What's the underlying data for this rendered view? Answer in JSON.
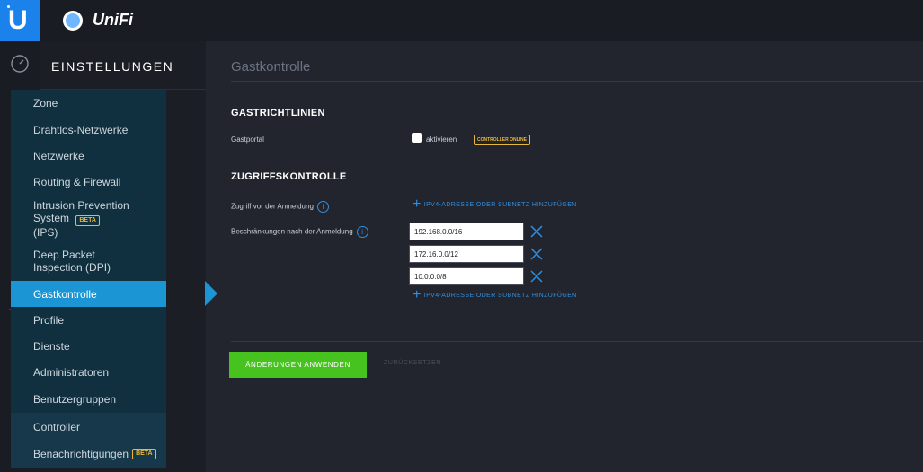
{
  "app": {
    "brand": "UniFi"
  },
  "sidebar": {
    "title": "EINSTELLUNGEN",
    "items": [
      {
        "label": "Zone"
      },
      {
        "label": "Drahtlos-Netzwerke"
      },
      {
        "label": "Netzwerke"
      },
      {
        "label": "Routing & Firewall"
      },
      {
        "label": "Intrusion Prevention System",
        "label2": "(IPS)",
        "badge": "BETA"
      },
      {
        "label": "Deep Packet",
        "label2": "Inspection (DPI)"
      },
      {
        "label": "Gastkontrolle"
      },
      {
        "label": "Profile"
      },
      {
        "label": "Dienste"
      },
      {
        "label": "Administratoren"
      },
      {
        "label": "Benutzergruppen"
      },
      {
        "label": "Controller"
      },
      {
        "label": "Benachrichtigungen",
        "badge": "BETA"
      }
    ]
  },
  "main": {
    "title": "Gastkontrolle",
    "guest_policies": {
      "heading": "GASTRICHTLINIEN",
      "portal_label": "Gastportal",
      "activate_label": "aktivieren",
      "controller_badge": "CONTROLLER ONLINE"
    },
    "access_control": {
      "heading": "ZUGRIFFSKONTROLLE",
      "pre_auth_label": "Zugriff vor der Anmeldung",
      "post_auth_label": "Beschränkungen nach der Anmeldung",
      "add_link": "IPV4-ADRESSE ODER SUBNETZ HINZUFÜGEN",
      "restrictions": [
        "192.168.0.0/16",
        "172.16.0.0/12",
        "10.0.0.0/8"
      ]
    },
    "actions": {
      "apply": "ÄNDERUNGEN ANWENDEN",
      "reset": "ZURÜCKSETZEN"
    }
  },
  "colors": {
    "accent": "#1b95d4",
    "apply": "#47c31f",
    "beta": "#e8b73b"
  }
}
